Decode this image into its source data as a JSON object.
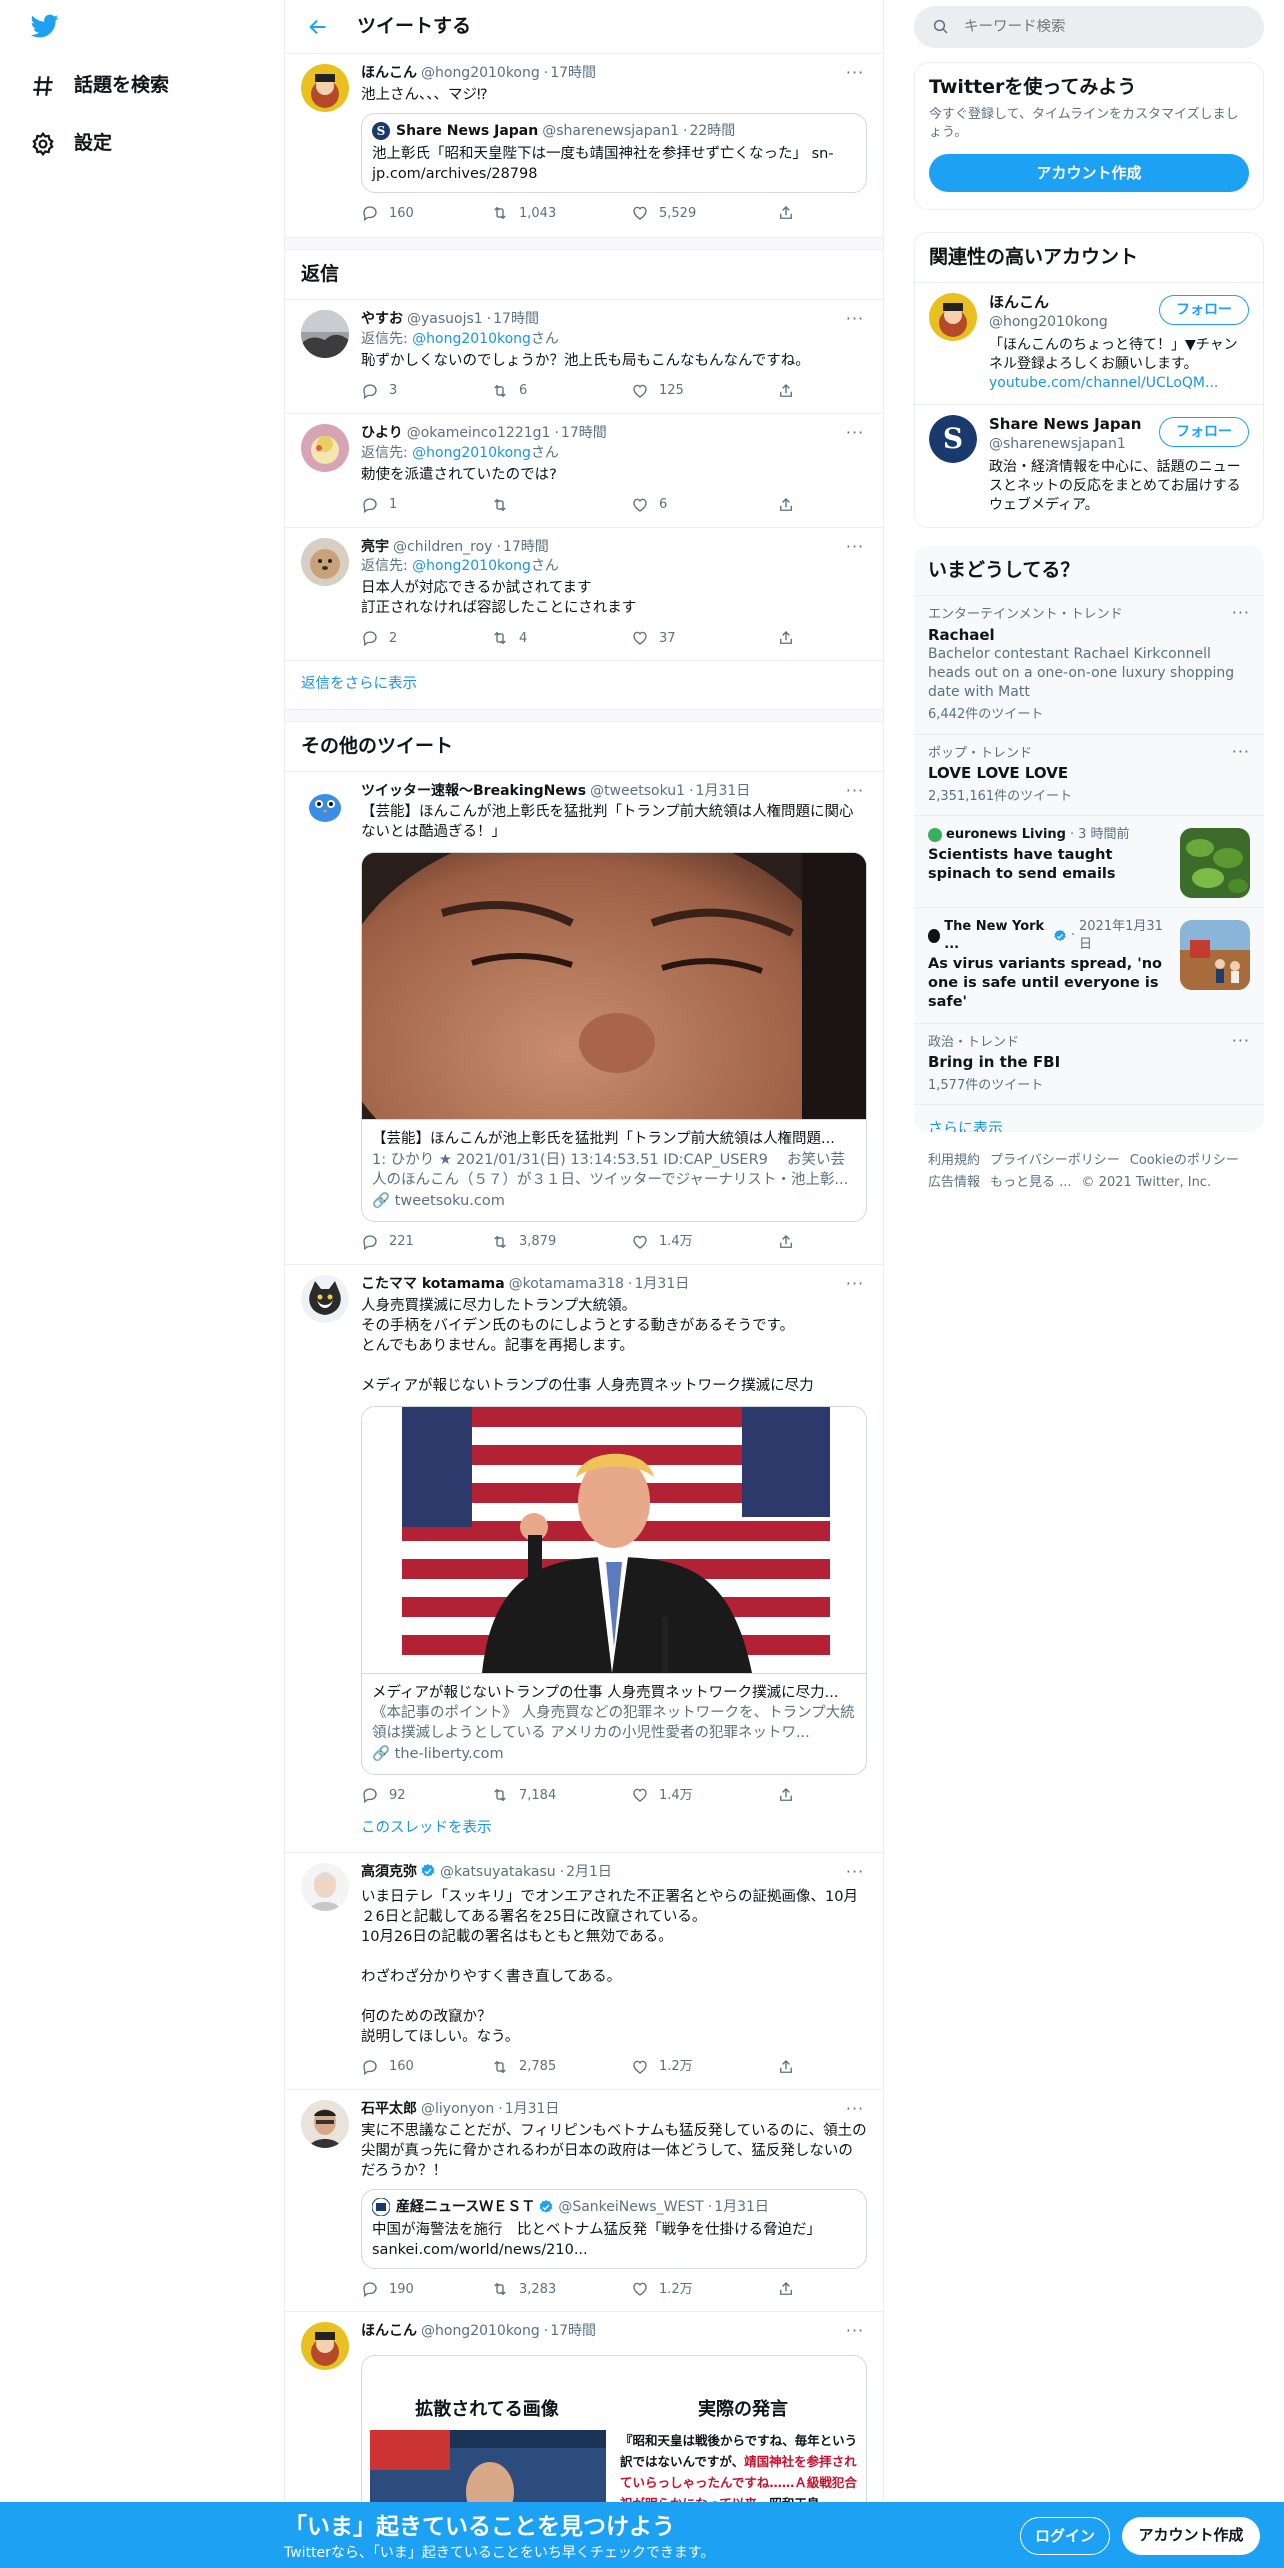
{
  "nav": {
    "explore": "話題を検索",
    "settings": "設定"
  },
  "header": {
    "title": "ツイートする"
  },
  "main_tweet": {
    "name": "ほんこん",
    "handle": "@hong2010kong",
    "time": "17時間",
    "text": "池上さん、、、マジ⁉",
    "quote": {
      "name": "Share News Japan",
      "handle": "@sharenewsjapan1",
      "time": "22時間",
      "text": "池上彰氏「昭和天皇陛下は一度も靖国神社を参拝せず亡くなった」 sn-jp.com/archives/28798"
    },
    "replies": "160",
    "retweets": "1,043",
    "likes": "5,529"
  },
  "replies_section": {
    "title": "返信",
    "show_more": "返信をさらに表示",
    "reply_prefix": "返信先:",
    "reply_suffix": "さん"
  },
  "replies": [
    {
      "name": "やすお",
      "handle": "@yasuojs1",
      "time": "17時間",
      "to": "@hong2010kong",
      "text": "恥ずかしくないのでしょうか？池上氏も局もこんなもんなんですね。",
      "replies": "3",
      "retweets": "6",
      "likes": "125"
    },
    {
      "name": "ひより",
      "handle": "@okameinco1221g1",
      "time": "17時間",
      "to": "@hong2010kong",
      "text": "勅使を派遣されていたのでは?",
      "replies": "1",
      "retweets": "",
      "likes": "6"
    },
    {
      "name": "亮宇",
      "handle": "@children_roy",
      "time": "17時間",
      "to": "@hong2010kong",
      "text": "日本人が対応できるか試されてます\n訂正されなければ容認したことにされます",
      "replies": "2",
      "retweets": "4",
      "likes": "37"
    }
  ],
  "others_section": {
    "title": "その他のツイート",
    "thread_link": "このスレッドを表示"
  },
  "others": [
    {
      "name": "ツイッター速報〜BreakingNews",
      "handle": "@tweetsoku1",
      "time": "1月31日",
      "text": "【芸能】ほんこんが池上彰氏を猛批判「トランプ前大統領は人権問題に関心ないとは酷過ぎる！」",
      "card_title": "【芸能】ほんこんが池上彰氏を猛批判「トランプ前大統領は人権問題...",
      "card_desc": "1: ひかり ★ 2021/01/31(日) 13:14:53.51 ID:CAP_USER9　 お笑い芸人のほんこん（５７）が３１日、ツイッターでジャーナリスト・池上彰...",
      "card_url": "tweetsoku.com",
      "replies": "221",
      "retweets": "3,879",
      "likes": "1.4万"
    },
    {
      "name": "こたママ kotamama",
      "handle": "@kotamama318",
      "time": "1月31日",
      "text": "人身売買撲滅に尽力したトランプ大統領。\nその手柄をバイデン氏のものにしようとする動きがあるそうです。\nとんでもありません。記事を再掲します。\n\nメディアが報じないトランプの仕事 人身売買ネットワーク撲滅に尽力",
      "card_title": "メディアが報じないトランプの仕事 人身売買ネットワーク撲滅に尽力...",
      "card_desc": "《本記事のポイント》 人身売買などの犯罪ネットワークを、トランプ大統領は撲滅しようとしている アメリカの小児性愛者の犯罪ネットワ...",
      "card_url": "the-liberty.com",
      "replies": "92",
      "retweets": "7,184",
      "likes": "1.4万"
    },
    {
      "name": "高須克弥",
      "handle": "@katsuyatakasu",
      "time": "2月1日",
      "text": "いま日テレ「スッキリ」でオンエアされた不正署名とやらの証拠画像、10月２6日と記載してある署名を25日に改竄されている。\n10月26日の記載の署名はもともと無効である。\n\nわざわざ分かりやすく書き直してある。\n\n何のための改竄か？\n説明してほしい。なう。",
      "replies": "160",
      "retweets": "2,785",
      "likes": "1.2万"
    },
    {
      "name": "石平太郎",
      "handle": "@liyonyon",
      "time": "1月31日",
      "text": "実に不思議なことだが、フィリピンもベトナムも猛反発しているのに、領土の尖閣が真っ先に脅かされるわが日本の政府は一体どうして、猛反発しないのだろうか？！",
      "quote": {
        "name": "産経ニュースＷＥＳＴ",
        "handle": "@SankeiNews_WEST",
        "time": "1月31日",
        "text": "中国が海警法を施行　比とベトナム猛反発「戦争を仕掛ける脅迫だ」 sankei.com/world/news/210..."
      },
      "replies": "190",
      "retweets": "3,283",
      "likes": "1.2万"
    },
    {
      "name": "ほんこん",
      "handle": "@hong2010kong",
      "time": "17時間",
      "image_left": "拡散されてる画像",
      "image_right": "実際の発言",
      "image_quote_black1": "『昭和天皇は戦後からですね、毎年という訳ではないんですが、",
      "image_quote_red": "靖国神社を参拝されていらっしゃったんですね……Ａ級戦犯合祀が明らかになって以来、",
      "image_quote_black2": "昭和天皇"
    }
  ],
  "right": {
    "search_placeholder": "キーワード検索",
    "signup": {
      "title": "Twitterを使ってみよう",
      "sub": "今すぐ登録して、タイムラインをカスタマイズしましょう。",
      "button": "アカウント作成"
    },
    "related": {
      "title": "関連性の高いアカウント",
      "follow": "フォロー",
      "accounts": [
        {
          "name": "ほんこん",
          "handle": "@hong2010kong",
          "bio": "「ほんこんのちょっと待て！」▼チャンネル登録よろしくお願いします。",
          "link": "youtube.com/channel/UCLoQM..."
        },
        {
          "name": "Share News Japan",
          "handle": "@sharenewsjapan1",
          "bio": "政治・経済情報を中心に、話題のニュースとネットの反応をまとめてお届けするウェブメディア。",
          "link": ""
        }
      ]
    },
    "trends": {
      "title": "いまどうしてる？",
      "show_more": "さらに表示",
      "items": [
        {
          "context": "エンターテインメント・トレンド",
          "name": "Rachael",
          "desc": "Bachelor contestant Rachael Kirkconnell heads out on a one-on-one luxury shopping date with Matt",
          "count": "6,442件のツイート"
        },
        {
          "context": "ポップ・トレンド",
          "name": "LOVE LOVE LOVE",
          "desc": "",
          "count": "2,351,161件のツイート"
        },
        {
          "source": "euronews Living",
          "time": "3 時間前",
          "name": "Scientists have taught spinach to send emails"
        },
        {
          "source": "The New York ...",
          "time": "2021年1月31日",
          "name": "As virus variants spread, 'no one is safe until everyone is safe'"
        },
        {
          "context": "政治・トレンド",
          "name": "Bring in the FBI",
          "desc": "",
          "count": "1,577件のツイート"
        }
      ]
    },
    "footer": {
      "links": [
        "利用規約",
        "プライバシーポリシー",
        "Cookieのポリシー",
        "広告情報",
        "もっと見る ..."
      ],
      "copyright": "© 2021 Twitter, Inc."
    }
  },
  "bottom_bar": {
    "title": "「いま」起きていることを見つけよう",
    "sub": "Twitterなら、「いま」起きていることをいち早くチェックできます。",
    "login": "ログイン",
    "signup": "アカウント作成"
  },
  "colors": {
    "accent": "#1da1f2",
    "link": "#1b95e0",
    "secondary": "#5b7083",
    "border": "#ebeef0"
  }
}
